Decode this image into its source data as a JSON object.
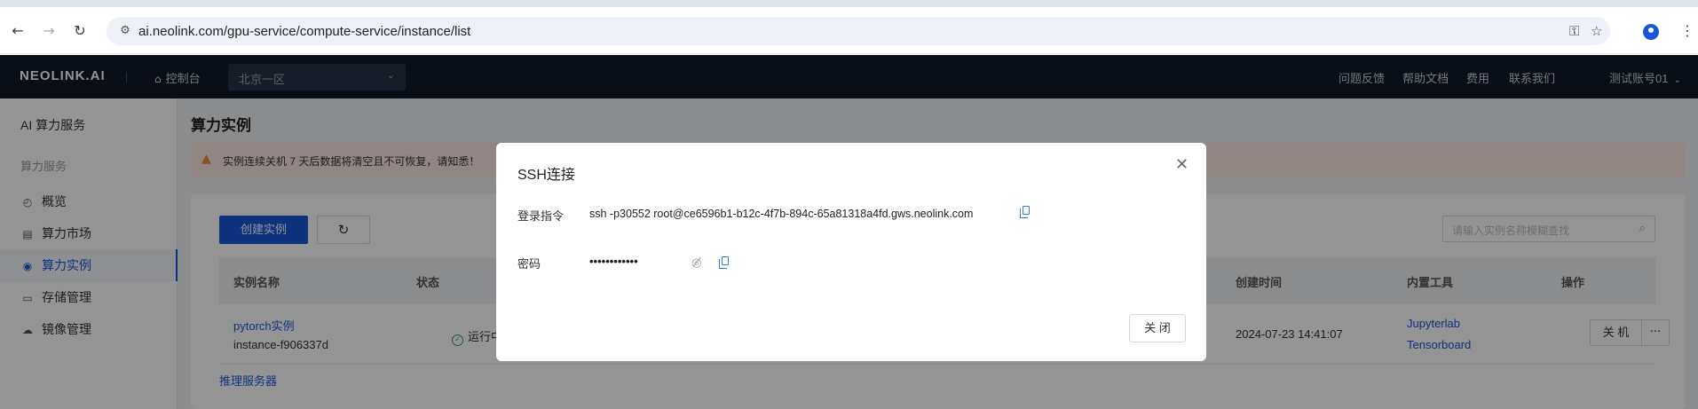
{
  "browser": {
    "url": "ai.neolink.com/gpu-service/compute-service/instance/list",
    "icons": [
      "back-icon",
      "forward-icon",
      "reload-icon",
      "site-info-icon",
      "key-icon",
      "star-icon",
      "profile-icon",
      "menu-icon"
    ]
  },
  "header": {
    "logo": "NEOLINK.AI",
    "home_label": "控制台",
    "region": "北京一区",
    "links": [
      "问题反馈",
      "帮助文档",
      "费用",
      "联系我们"
    ],
    "account": "测试账号01"
  },
  "sidebar": {
    "title": "AI 算力服务",
    "group": "算力服务",
    "items": [
      {
        "label": "概览",
        "icon": "dashboard-icon"
      },
      {
        "label": "算力市场",
        "icon": "market-icon"
      },
      {
        "label": "算力实例",
        "icon": "instance-icon",
        "active": true
      },
      {
        "label": "存储管理",
        "icon": "storage-icon"
      },
      {
        "label": "镜像管理",
        "icon": "image-icon"
      }
    ]
  },
  "main": {
    "title": "算力实例",
    "alert": "实例连续关机 7 天后数据将清空且不可恢复，请知悉！",
    "create_button": "创建实例",
    "search_placeholder": "请输入实例名称模糊查找",
    "columns": [
      "实例名称",
      "状态",
      "创建时间",
      "内置工具",
      "操作"
    ],
    "rows": [
      {
        "name": "pytorch实例",
        "instance_id": "instance-f906337d",
        "status": "运行中",
        "created": "2024-07-23 14:41:07",
        "tools": [
          "Jupyterlab",
          "Tensorboard"
        ],
        "action": "关 机",
        "more": "···"
      }
    ],
    "partial_row": "推理服务器"
  },
  "modal": {
    "title": "SSH连接",
    "login_label": "登录指令",
    "login_cmd": "ssh -p30552 root@ce6596b1-b12c-4f7b-894c-65a81318a4fd.gws.neolink.com",
    "password_label": "密码",
    "password_masked": "••••••••••••",
    "close_button": "关 闭"
  },
  "colors": {
    "accent": "#1a56db",
    "header_bg": "#0f1726",
    "alert_bg": "#fbe7e3",
    "success": "#2e9e4a"
  }
}
